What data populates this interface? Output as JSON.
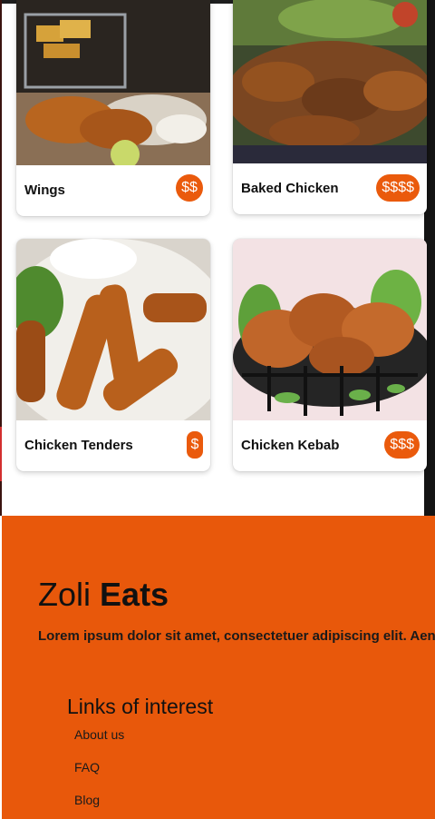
{
  "menu": {
    "items": [
      {
        "name": "Wings",
        "price": "$$"
      },
      {
        "name": "Baked Chicken",
        "price": "$$$$"
      },
      {
        "name": "Chicken Tenders",
        "price": "$"
      },
      {
        "name": "Chicken Kebab",
        "price": "$$$"
      }
    ]
  },
  "footer": {
    "brand_light": "Zoli",
    "brand_bold": "Eats",
    "tagline": "Lorem ipsum dolor sit amet, consectetuer adipiscing elit. Aen",
    "links_title": "Links of interest",
    "links": [
      "About us",
      "FAQ",
      "Blog"
    ]
  },
  "colors": {
    "accent": "#ea5a0c",
    "footer_bg": "#e8580b"
  }
}
